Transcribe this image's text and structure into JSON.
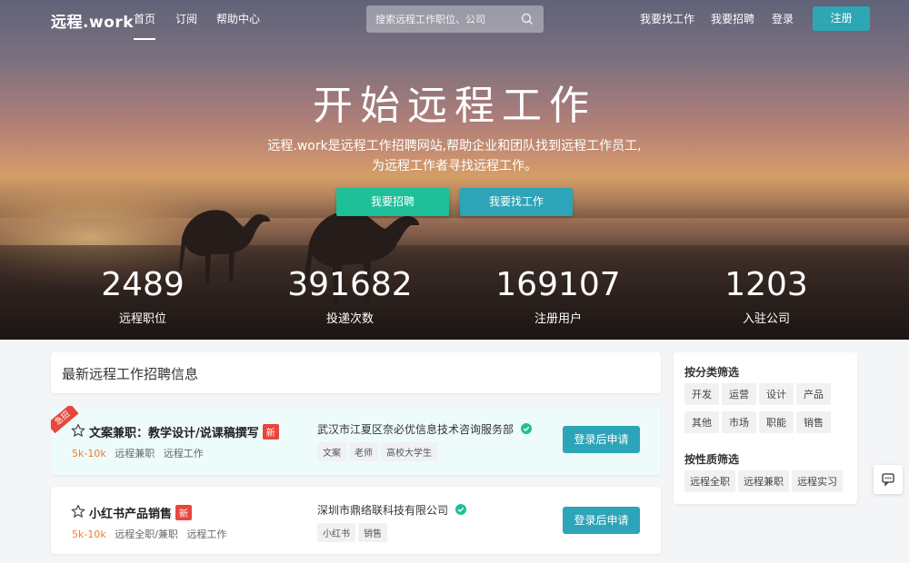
{
  "nav": {
    "logo": "远程.work",
    "links": [
      "首页",
      "订阅",
      "帮助中心"
    ],
    "search_placeholder": "搜索远程工作职位、公司",
    "right_links": [
      "我要找工作",
      "我要招聘",
      "登录"
    ],
    "register": "注册"
  },
  "hero": {
    "title": "开始远程工作",
    "subtitle_line1": "远程.work是远程工作招聘网站,帮助企业和团队找到远程工作员工,",
    "subtitle_line2": "为远程工作者寻找远程工作。",
    "btn_hire": "我要招聘",
    "btn_find": "我要找工作"
  },
  "stats": [
    {
      "value": "2489",
      "label": "远程职位"
    },
    {
      "value": "391682",
      "label": "投递次数"
    },
    {
      "value": "169107",
      "label": "注册用户"
    },
    {
      "value": "1203",
      "label": "入驻公司"
    }
  ],
  "jobs_header": "最新远程工作招聘信息",
  "jobs": [
    {
      "ribbon": "急招",
      "title": "文案兼职：教学设计/说课稿撰写",
      "new_badge": "新",
      "salary": "5k-10k",
      "type": "远程兼职",
      "category": "远程工作",
      "company": "武汉市江夏区奈必优信息技术咨询服务部",
      "tags": [
        "文案",
        "老师",
        "高校大学生"
      ],
      "apply": "登录后申请"
    },
    {
      "title": "小红书产品销售",
      "new_badge": "新",
      "salary": "5k-10k",
      "type": "远程全职/兼职",
      "category": "远程工作",
      "company": "深圳市鼎络联科技有限公司",
      "tags": [
        "小红书",
        "销售"
      ],
      "apply": "登录后申请"
    }
  ],
  "sidebar": {
    "category_title": "按分类筛选",
    "categories": [
      "开发",
      "运营",
      "设计",
      "产品",
      "其他",
      "市场",
      "职能",
      "销售"
    ],
    "nature_title": "按性质筛选",
    "natures": [
      "远程全职",
      "远程兼职",
      "远程实习"
    ]
  },
  "colors": {
    "accent": "#2ea4b8",
    "green": "#1fbf99",
    "red": "#e8473c",
    "salary": "#f47b2e"
  }
}
